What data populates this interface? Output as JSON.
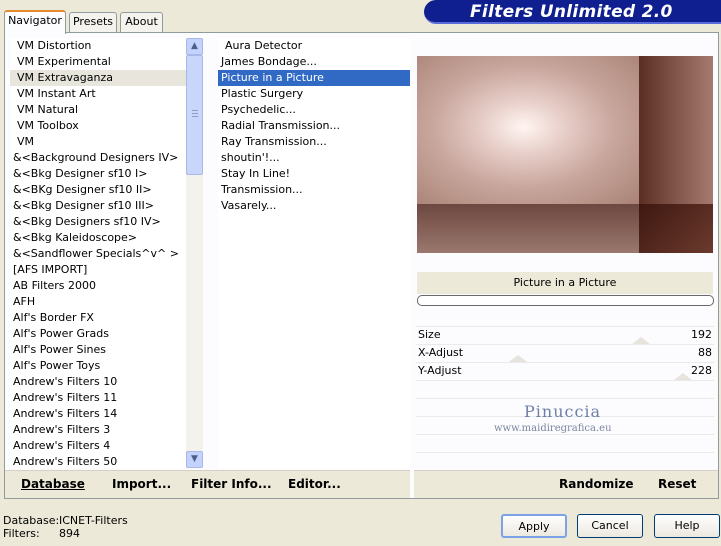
{
  "tabs": [
    "Navigator",
    "Presets",
    "About"
  ],
  "banner_title": "Filters Unlimited 2.0",
  "categories": [
    "VM Distortion",
    "VM Experimental",
    "VM Extravaganza",
    "VM Instant Art",
    "VM Natural",
    "VM Toolbox",
    "VM",
    "&<Background Designers IV>",
    "&<Bkg Designer sf10 I>",
    "&<BKg Designer sf10 II>",
    "&<Bkg Designer sf10 III>",
    "&<Bkg Designers sf10 IV>",
    "&<Bkg Kaleidoscope>",
    "&<Sandflower Specials^v^ >",
    "[AFS IMPORT]",
    "AB Filters 2000",
    "AFH",
    "Alf's Border FX",
    "Alf's Power Grads",
    "Alf's Power Sines",
    "Alf's Power Toys",
    "Andrew's Filters 10",
    "Andrew's Filters 11",
    "Andrew's Filters 14",
    "Andrew's Filters 3",
    "Andrew's Filters 4",
    "Andrew's Filters 50"
  ],
  "selected_category": "VM Extravaganza",
  "filters": [
    "Aura Detector",
    "James Bondage...",
    "Picture in a Picture",
    "Plastic Surgery",
    "Psychedelic...",
    "Radial Transmission...",
    "Ray Transmission...",
    "shoutin'!...",
    "Stay In Line!",
    "Transmission...",
    "Vasarely..."
  ],
  "selected_filter": "Picture in a Picture",
  "left_buttons": {
    "database": "Database",
    "import": "Import...",
    "filter_info": "Filter Info...",
    "editor": "Editor..."
  },
  "filter_name": "Picture in a Picture",
  "params": [
    {
      "label": "Size",
      "value": "192"
    },
    {
      "label": "X-Adjust",
      "value": "88"
    },
    {
      "label": "Y-Adjust",
      "value": "228"
    }
  ],
  "right_buttons": {
    "randomize": "Randomize",
    "reset": "Reset"
  },
  "watermark": {
    "line1": "Pinuccia",
    "line2": "www.maidiregrafica.eu"
  },
  "status": {
    "database_label": "Database:",
    "database_value": "ICNET-Filters",
    "filters_label": "Filters:",
    "filters_value": "894"
  },
  "dialog_buttons": {
    "apply": "Apply",
    "cancel": "Cancel",
    "help": "Help"
  }
}
